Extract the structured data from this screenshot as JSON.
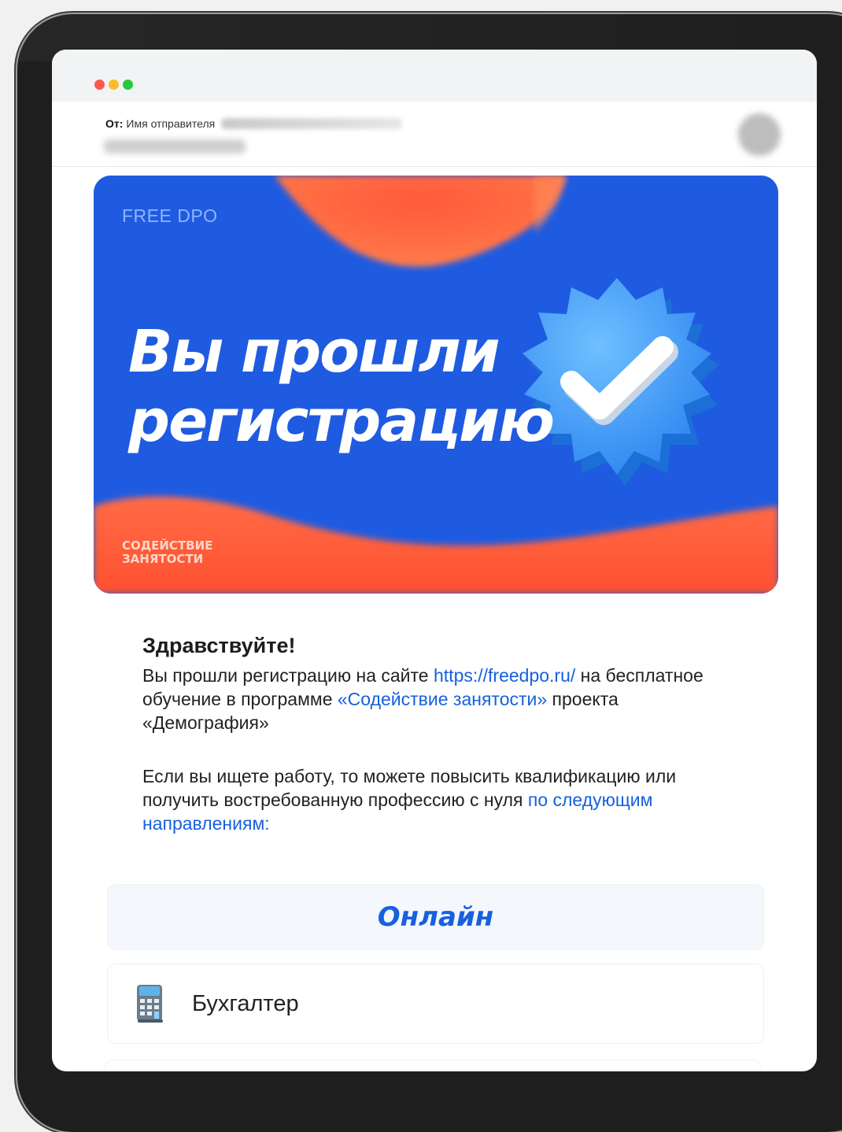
{
  "window": {
    "controls": [
      "close",
      "minimize",
      "maximize"
    ]
  },
  "mail": {
    "from_label": "От:",
    "sender_name": "Имя отправителя"
  },
  "banner": {
    "brand": "FREE DPO",
    "title_line1": "Вы прошли",
    "title_line2": "регистрацию",
    "footer_line1": "СОДЕЙСТВИЕ",
    "footer_line2": "ЗАНЯТОСТИ",
    "badge_icon": "verified-check-icon"
  },
  "body": {
    "greeting": "Здравствуйте!",
    "p1_text1": "Вы прошли регистрацию на сайте ",
    "p1_link1": "https://freedpo.ru/",
    "p1_text2": " на бесплатное обучение в программе ",
    "p1_link2": "«Содействие занятости»",
    "p1_text3": " проекта «Демография»",
    "p2_text1": "Если вы ищете работу, то можете повысить квалификацию или получить востребованную профессию с нуля ",
    "p2_link1": "по следующим направлениям:"
  },
  "sections": {
    "online_label": "Онлайн",
    "courses": [
      {
        "label": "Бухгалтер",
        "icon": "calculator-icon"
      }
    ]
  },
  "colors": {
    "accent": "#1760e0",
    "banner_blue": "#1f5be0",
    "banner_orange": "#ff6a3d"
  }
}
